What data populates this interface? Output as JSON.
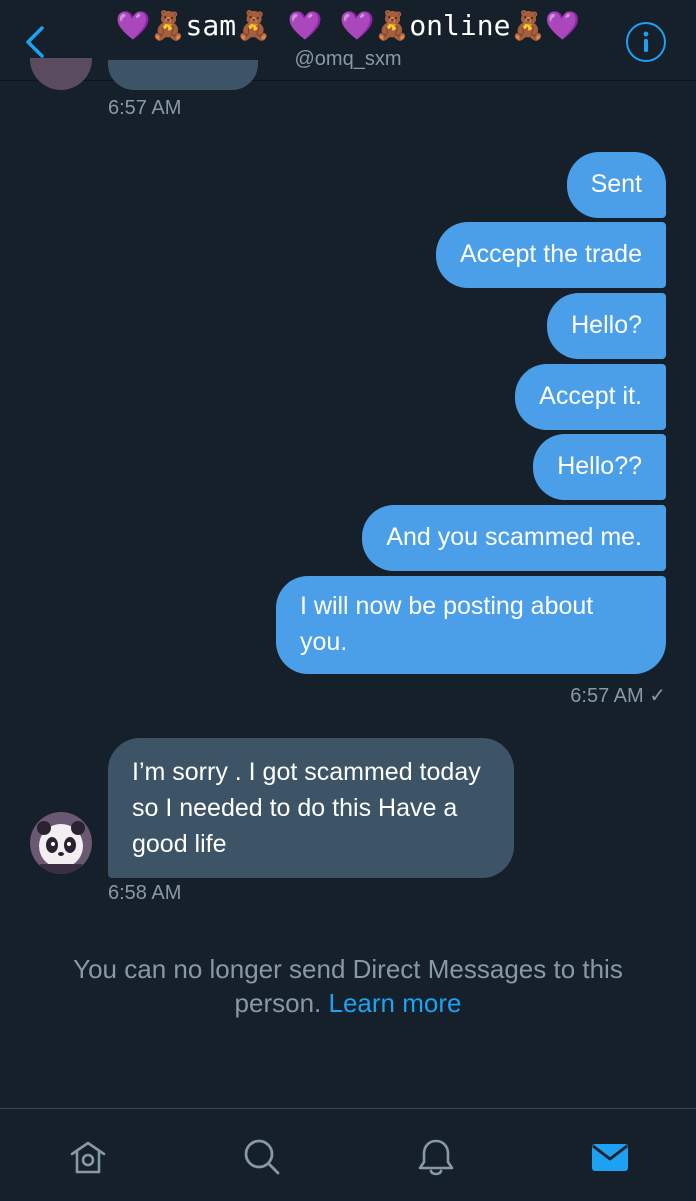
{
  "header": {
    "title_left": "sam",
    "title_right": "online",
    "handle": "@omq_sxm",
    "emoji": {
      "heart": "💜",
      "bear": "🧸"
    }
  },
  "conversation": {
    "top_timestamp": "6:57 AM",
    "sent_messages": [
      "Sent",
      "Accept the trade",
      "Hello?",
      "Accept it.",
      "Hello??",
      "And you scammed me.",
      "I will now be posting about you."
    ],
    "sent_timestamp": "6:57 AM ✓",
    "received_message": "I’m sorry . I got scammed today so I needed to do this  Have a good life",
    "received_timestamp": "6:58 AM"
  },
  "notice": {
    "text": "You can no longer send Direct Messages to this person.",
    "link": "Learn more"
  },
  "tabbar": {
    "items": [
      "home-icon",
      "search-icon",
      "notifications-icon",
      "messages-icon"
    ],
    "active": "messages-icon"
  },
  "colors": {
    "background": "#15202b",
    "accent": "#1da1f2",
    "sent_bubble": "#4a9fe8",
    "received_bubble": "#3d5466",
    "secondary_text": "#8899a6"
  }
}
